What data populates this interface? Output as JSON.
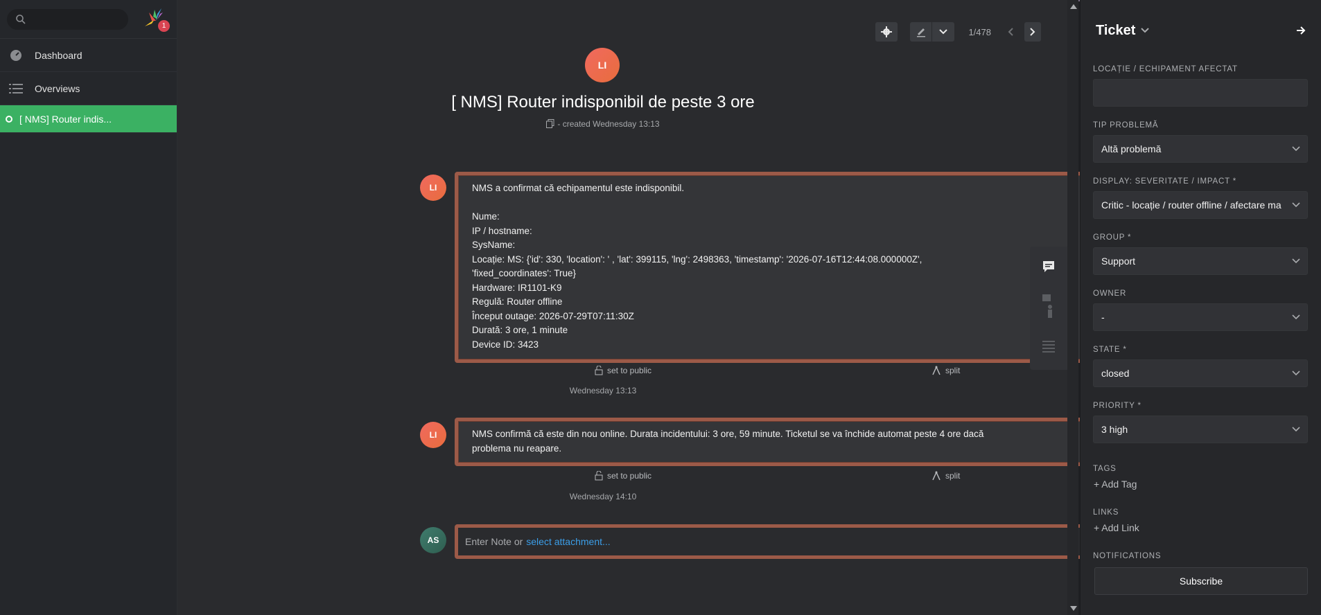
{
  "nav": {
    "search_placeholder": "",
    "badge_count": "1",
    "items": [
      {
        "label": "Dashboard"
      },
      {
        "label": "Overviews"
      }
    ],
    "active_tab": "[ NMS] Router  indis..."
  },
  "toolbar": {
    "pager": "1/478"
  },
  "ticket": {
    "avatar": "LI",
    "title": "[ NMS] Router  indisponibil de peste 3 ore",
    "created": "- created Wednesday 13:13"
  },
  "articles": [
    {
      "avatar": "LI",
      "lines": [
        "NMS a confirmat că echipamentul este indisponibil.",
        "",
        "Nume:",
        "IP / hostname:",
        "SysName:",
        "Locație: MS: {'id': 330, 'location': ' , 'lat': 399115, 'lng': 2498363, 'timestamp': '2026-07-16T12:44:08.000000Z',",
        "'fixed_coordinates': True}",
        "Hardware: IR1101-K9",
        "Regulă: Router offline",
        "Început outage: 2026-07-29T07:11:30Z",
        "Durată: 3 ore, 1 minute",
        "Device ID: 3423"
      ],
      "set_public": "set to public",
      "split": "split",
      "date": "Wednesday 13:13"
    },
    {
      "avatar": "LI",
      "lines": [
        "NMS confirmă că  este din nou online. Durata incidentului: 3 ore, 59 minute. Ticketul se va închide automat peste 4 ore dacă",
        "problema nu reapare."
      ],
      "set_public": "set to public",
      "split": "split",
      "date": "Wednesday 14:10"
    }
  ],
  "note": {
    "avatar": "AS",
    "placeholder": "Enter Note or",
    "link": "select attachment..."
  },
  "sidebar": {
    "title": "Ticket",
    "fields": [
      {
        "label": "Locație / Echipament afectat",
        "value": ""
      },
      {
        "label": "Tip problemă",
        "value": "Altă problemă"
      },
      {
        "label": "Display: Severitate / Impact *",
        "value": "Critic - locație / router offline / afectare ma"
      },
      {
        "label": "Group *",
        "value": "Support"
      },
      {
        "label": "Owner",
        "value": "-"
      },
      {
        "label": "State *",
        "value": "closed"
      },
      {
        "label": "Priority *",
        "value": "3 high"
      }
    ],
    "tags_label": "Tags",
    "add_tag": "+ Add Tag",
    "links_label": "Links",
    "add_link": "+ Add Link",
    "notifications_label": "Notifications",
    "subscribe": "Subscribe"
  }
}
